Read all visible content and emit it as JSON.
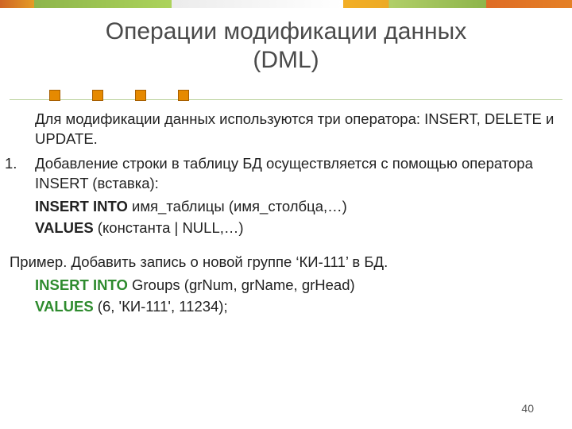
{
  "title_line1": "Операции модификации данных",
  "title_line2": "(DML)",
  "intro": "Для модификации данных используются три оператора: INSERT, DELETE и UPDATE.",
  "item1_num": "1.",
  "item1_text": "Добавление строки в таблицу БД осуществляется с помощью оператора INSERT (вставка):",
  "syntax1_kw": "INSERT INTO",
  "syntax1_rest": " имя_таблицы (имя_столбца,…)",
  "syntax2_kw": "VALUES",
  "syntax2_rest": " (константа | NULL,…)",
  "example_label": "Пример. Добавить запись о новой группе ‘КИ-111’ в БД.",
  "ex1_kw": "INSERT INTO",
  "ex1_rest": " Groups (grNum, grName, grHead)",
  "ex2_kw": "VALUES",
  "ex2_rest": " (6, 'КИ-111', 11234);",
  "page_number": "40"
}
